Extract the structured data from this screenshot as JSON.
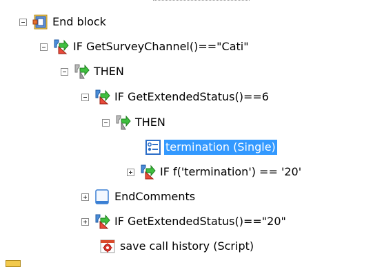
{
  "tree": {
    "nodes": [
      {
        "label": "End block",
        "icon": "block-icon",
        "toggle": "minus"
      },
      {
        "label": "IF GetSurveyChannel()==\"Cati\"",
        "icon": "if-condition-icon",
        "toggle": "minus"
      },
      {
        "label": "THEN",
        "icon": "then-branch-icon",
        "toggle": "minus"
      },
      {
        "label": "IF GetExtendedStatus()==6",
        "icon": "if-condition-icon",
        "toggle": "minus"
      },
      {
        "label": "THEN",
        "icon": "then-branch-icon",
        "toggle": "minus"
      },
      {
        "label": "termination (Single)",
        "icon": "single-question-icon",
        "toggle": "none",
        "selected": true
      },
      {
        "label": "IF f('termination') == '20'",
        "icon": "if-condition-icon",
        "toggle": "plus"
      },
      {
        "label": "EndComments",
        "icon": "page-icon",
        "toggle": "plus"
      },
      {
        "label": "IF GetExtendedStatus()==\"20\"",
        "icon": "if-condition-icon",
        "toggle": "plus"
      },
      {
        "label": "save call history (Script)",
        "icon": "script-gear-icon",
        "toggle": "none"
      }
    ]
  },
  "colors": {
    "selection": "#3399ff",
    "selection_text": "#ffffff"
  }
}
